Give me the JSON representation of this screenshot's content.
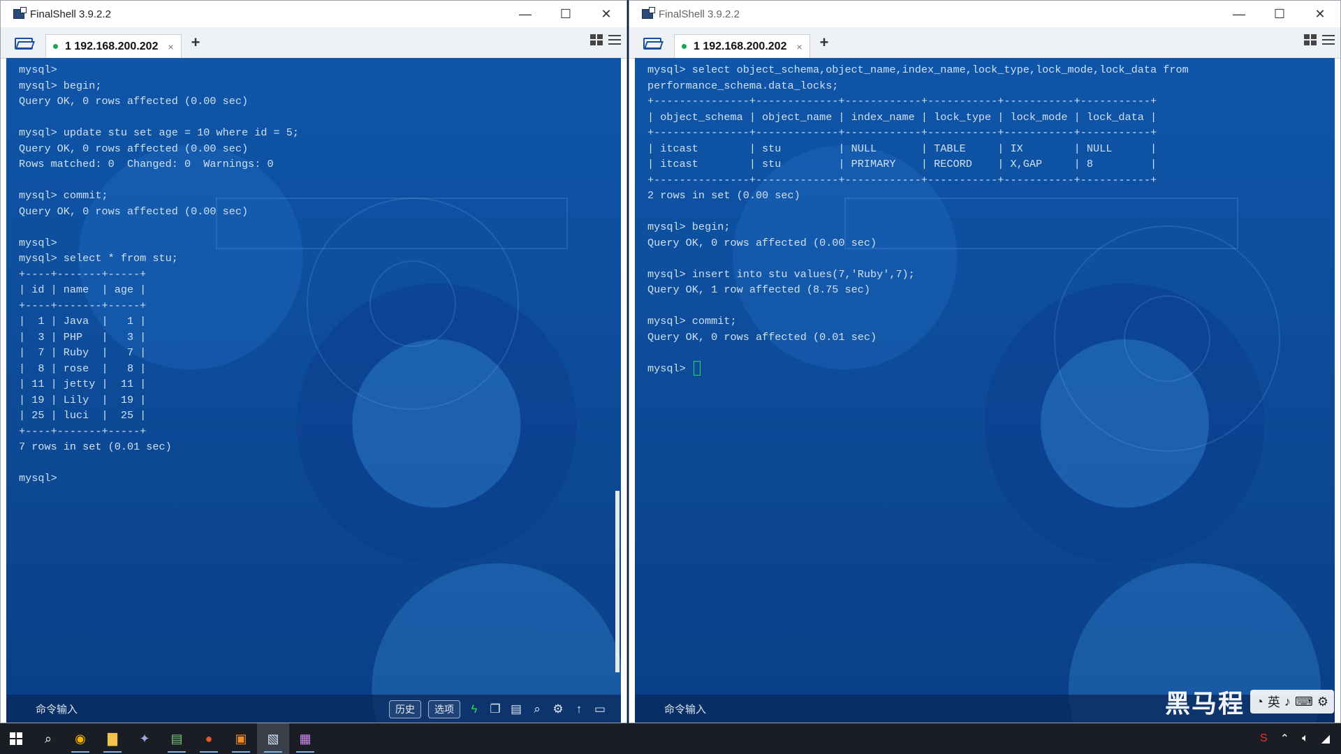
{
  "windows": {
    "left": {
      "title": "FinalShell 3.9.2.2",
      "tab_label": "1 192.168.200.202",
      "terminal_text": "mysql>\nmysql> begin;\nQuery OK, 0 rows affected (0.00 sec)\n\nmysql> update stu set age = 10 where id = 5;\nQuery OK, 0 rows affected (0.00 sec)\nRows matched: 0  Changed: 0  Warnings: 0\n\nmysql> commit;\nQuery OK, 0 rows affected (0.00 sec)\n\nmysql>\nmysql> select * from stu;\n+----+-------+-----+\n| id | name  | age |\n+----+-------+-----+\n|  1 | Java  |   1 |\n|  3 | PHP   |   3 |\n|  7 | Ruby  |   7 |\n|  8 | rose  |   8 |\n| 11 | jetty |  11 |\n| 19 | Lily  |  19 |\n| 25 | luci  |  25 |\n+----+-------+-----+\n7 rows in set (0.01 sec)\n\nmysql>",
      "cmd_input_label": "命令输入",
      "history_button": "历史",
      "options_button": "选项"
    },
    "right": {
      "title": "FinalShell 3.9.2.2",
      "tab_label": "1 192.168.200.202",
      "terminal_text": "mysql> select object_schema,object_name,index_name,lock_type,lock_mode,lock_data from\nperformance_schema.data_locks;\n+---------------+-------------+------------+-----------+-----------+-----------+\n| object_schema | object_name | index_name | lock_type | lock_mode | lock_data |\n+---------------+-------------+------------+-----------+-----------+-----------+\n| itcast        | stu         | NULL       | TABLE     | IX        | NULL      |\n| itcast        | stu         | PRIMARY    | RECORD    | X,GAP     | 8         |\n+---------------+-------------+------------+-----------+-----------+-----------+\n2 rows in set (0.00 sec)\n\nmysql> begin;\nQuery OK, 0 rows affected (0.00 sec)\n\nmysql> insert into stu values(7,'Ruby',7);\nQuery OK, 1 row affected (8.75 sec)\n\nmysql> commit;\nQuery OK, 0 rows affected (0.01 sec)\n\nmysql> ",
      "cmd_input_label": "命令输入"
    }
  },
  "window_controls": {
    "minimize": "—",
    "maximize": "☐",
    "close": "✕"
  },
  "tab_close": "×",
  "add_tab": "+",
  "watermark": "黑马程",
  "ime": {
    "lang": "英"
  },
  "colors": {
    "terminal_bg": "#0d4c9a",
    "terminal_text": "#cfe0f3",
    "cursor": "#29d36a",
    "connected_dot": "#18a84a"
  }
}
